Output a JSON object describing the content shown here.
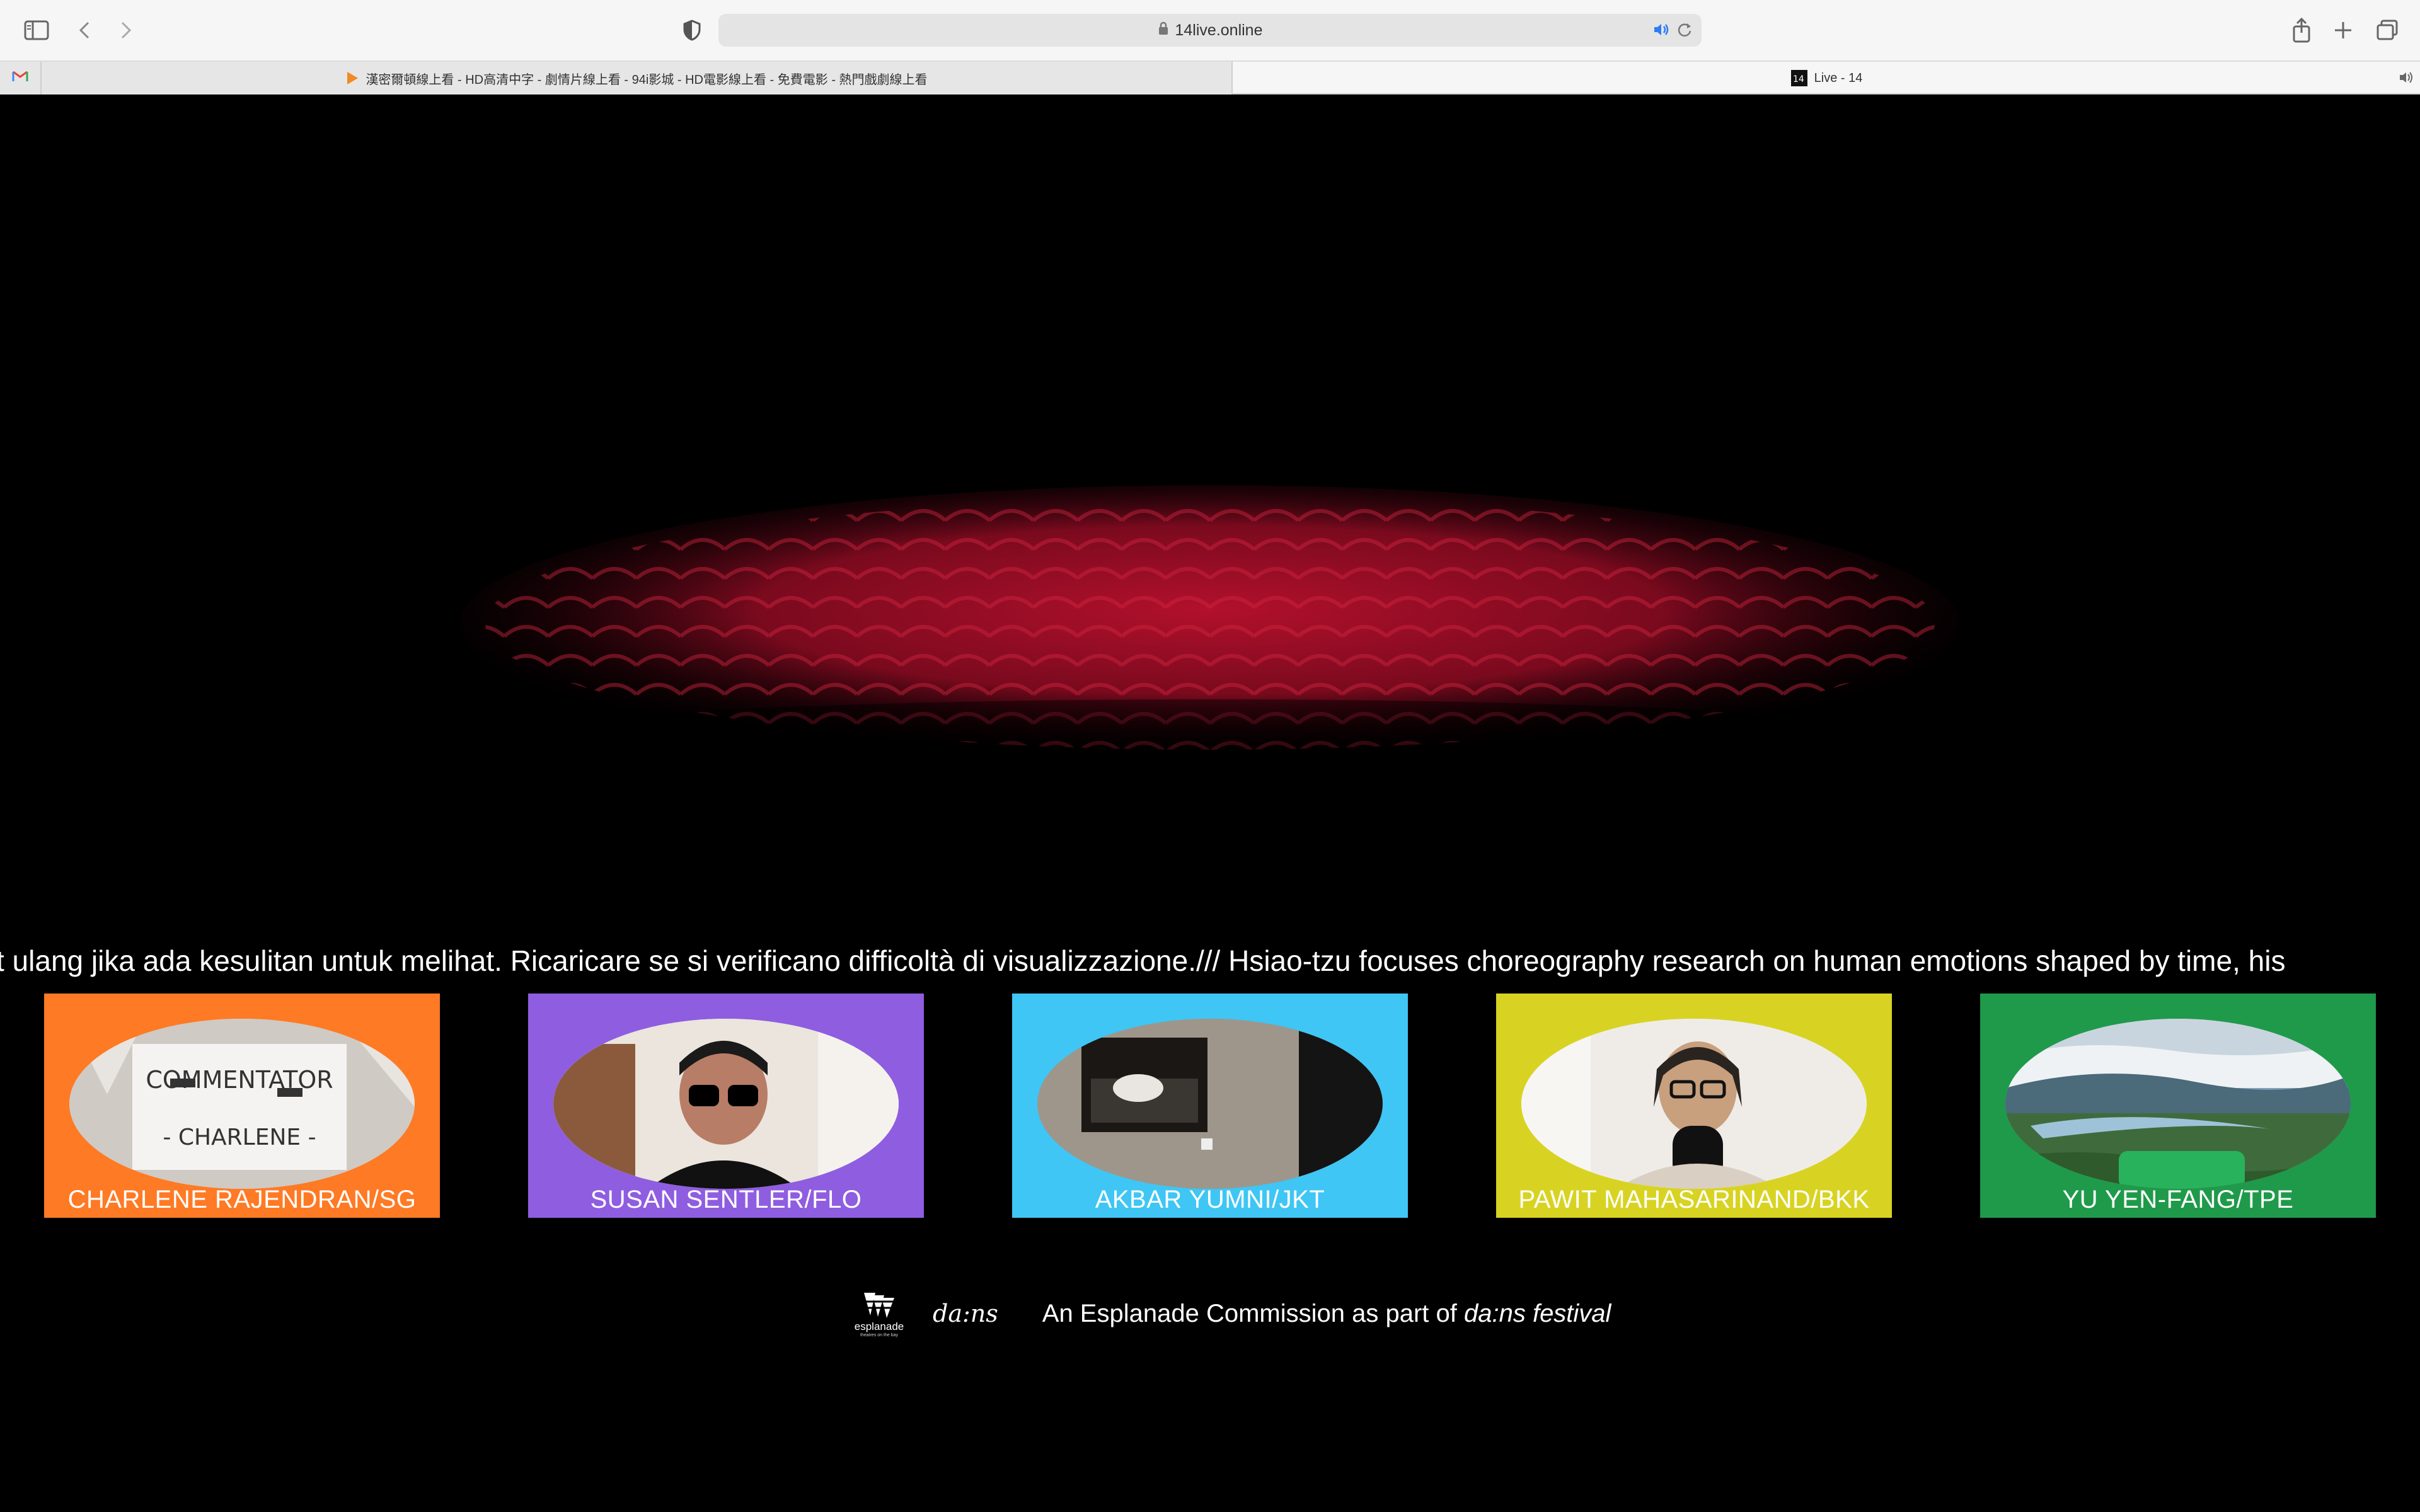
{
  "browser": {
    "url": "14live.online",
    "tabs": [
      {
        "label": "漢密爾頓線上看 - HD高清中字 - 劇情片線上看 - 94i影城 - HD電影線上看 - 免費電影 - 熱門戲劇線上看",
        "active": false
      },
      {
        "label": "Live - 14",
        "active": true
      }
    ],
    "gmail_icon": "M"
  },
  "ticker": {
    "text": "t ulang jika ada kesulitan untuk melihat. Ricaricare se si verificano difficoltà di visualizzazione./// Hsiao-tzu focuses choreography research on human emotions shaped by time, his"
  },
  "panels": [
    {
      "name": "CHARLENE RAJENDRAN/SG",
      "color": "#ff7a24",
      "sign_line1": "COMMENTATOR",
      "sign_line2": "- CHARLENE -"
    },
    {
      "name": "SUSAN SENTLER/FLO",
      "color": "#8f5de0"
    },
    {
      "name": "AKBAR YUMNI/JKT",
      "color": "#3fc6f4"
    },
    {
      "name": "PAWIT MAHASARINAND/BKK",
      "color": "#d8d323"
    },
    {
      "name": "YU YEN-FANG/TPE",
      "color": "#1f9a4a"
    }
  ],
  "footer": {
    "esplanade_word": "esplanade",
    "esplanade_tag": "theatres on the bay",
    "dans_logo": "da:ns",
    "credit_prefix": "An Esplanade Commission as part of ",
    "credit_festival": "da:ns festival"
  }
}
